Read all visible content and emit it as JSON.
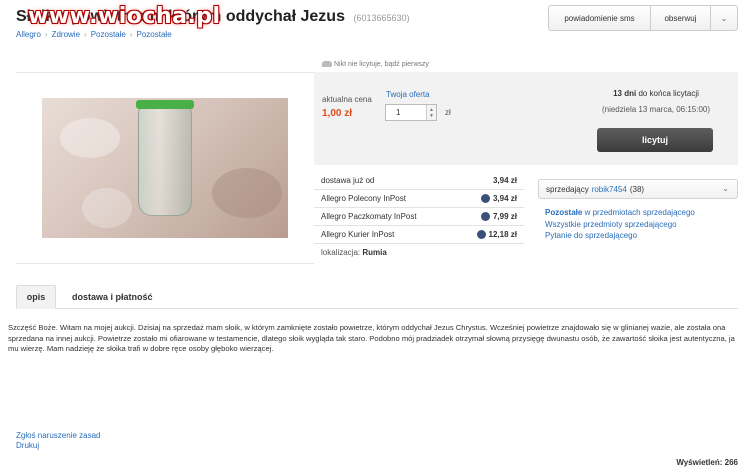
{
  "header": {
    "title": "Słoik z powietrzem, którym oddychał Jezus",
    "item_id": "(6013665630)",
    "watermark": "www.wiocha.pl",
    "breadcrumb": [
      "Allegro",
      "Zdrowie",
      "Pozostałe",
      "Pozostałe"
    ]
  },
  "actions": {
    "sms_label": "powiadomienie sms",
    "watch_label": "obserwuj",
    "more_icon": "chevron-down-icon"
  },
  "bids_info": "Nikt nie licytuje, bądź pierwszy",
  "buy": {
    "price_label": "aktualna cena",
    "price_value": "1,00 zł",
    "offer_label": "Twoja oferta",
    "offer_value": "1",
    "currency": "zł",
    "time_days": "13 dni",
    "time_suffix": "do końca licytacji",
    "end_date": "(niedziela 13 marca, 06:15:00)",
    "bid_button": "licytuj"
  },
  "shipping": {
    "from_label": "dostawa już od",
    "from_price": "3,94 zł",
    "options": [
      {
        "name": "Allegro Polecony InPost",
        "price": "3,94 zł"
      },
      {
        "name": "Allegro Paczkomaty InPost",
        "price": "7,99 zł"
      },
      {
        "name": "Allegro Kurier InPost",
        "price": "12,18 zł"
      }
    ],
    "location_label": "lokalizacja:",
    "location_value": "Rumia"
  },
  "seller": {
    "label": "sprzedający",
    "name": "robik7454",
    "rating": "(38)",
    "links": {
      "other_bold": "Pozostałe",
      "other_rest": "w przedmiotach sprzedającego",
      "all_items": "Wszystkie przedmioty sprzedającego",
      "ask": "Pytanie do sprzedającego"
    }
  },
  "tabs": [
    "opis",
    "dostawa i płatność"
  ],
  "description": "Szczęść Boże. Witam na mojej aukcji. Dzisiaj na sprzedaż mam słoik, w którym zamknięte zostało powietrze, którym oddychał Jezus Chrystus. Wcześniej powietrze znajdowało się w glinianej wazie, ale została ona sprzedana na innej aukcji. Powietrze zostało mi ofiarowane w testamencie, dlatego słoik wygląda tak staro. Podobno mój pradziadek otrzymał słowną przysięgę dwunastu osób, że zawartość słoika jest autentyczna, ja mu wierzę. Mam nadzieję że słoika trafi w dobre ręce osoby głęboko wierzącej.",
  "footer": {
    "report": "Zgłoś naruszenie zasad",
    "print": "Drukuj",
    "views_label": "Wyświetleń:",
    "views_count": "266"
  }
}
